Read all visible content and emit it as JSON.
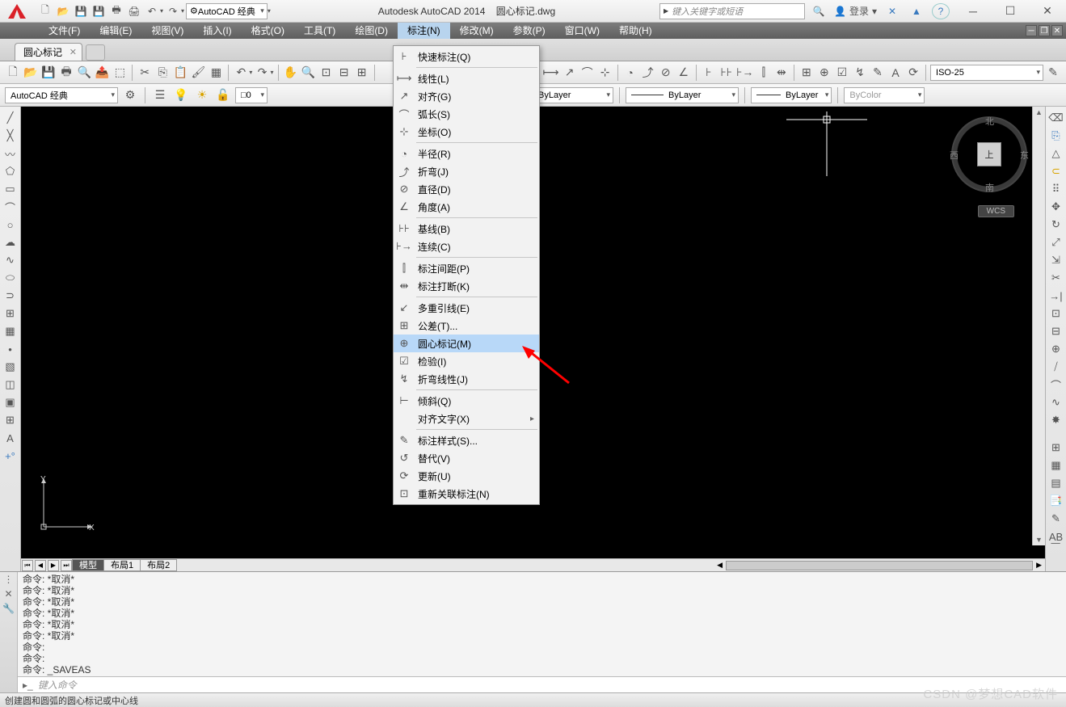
{
  "titlebar": {
    "app_icon": "A",
    "workspace_selector": "AutoCAD 经典",
    "app_title": "Autodesk AutoCAD 2014",
    "doc_title": "圆心标记.dwg",
    "search_placeholder": "键入关键字或短语",
    "login_label": "登录"
  },
  "menubar": {
    "items": [
      "文件(F)",
      "编辑(E)",
      "视图(V)",
      "插入(I)",
      "格式(O)",
      "工具(T)",
      "绘图(D)",
      "标注(N)",
      "修改(M)",
      "参数(P)",
      "窗口(W)",
      "帮助(H)"
    ],
    "active_index": 7
  },
  "doctab": {
    "label": "圆心标记"
  },
  "row2": {
    "workspace": "AutoCAD 经典",
    "layer_name": "0",
    "bylayer1": "ByLayer",
    "bylayer2": "ByLayer",
    "bylayer3": "ByLayer",
    "bycolor": "ByColor",
    "dimstyle": "ISO-25"
  },
  "viewcube": {
    "face": "上",
    "n": "北",
    "s": "南",
    "e": "东",
    "w": "西",
    "wcs": "WCS"
  },
  "layout_tabs": {
    "model": "模型",
    "l1": "布局1",
    "l2": "布局2"
  },
  "dropdown": {
    "items": [
      {
        "label": "快速标注(Q)",
        "icon": "⊦"
      },
      {
        "sep": true
      },
      {
        "label": "线性(L)",
        "icon": "⟼"
      },
      {
        "label": "对齐(G)",
        "icon": "↗"
      },
      {
        "label": "弧长(S)",
        "icon": "⌒"
      },
      {
        "label": "坐标(O)",
        "icon": "⊹"
      },
      {
        "sep": true
      },
      {
        "label": "半径(R)",
        "icon": "◔"
      },
      {
        "label": "折弯(J)",
        "icon": "⤴"
      },
      {
        "label": "直径(D)",
        "icon": "⊘"
      },
      {
        "label": "角度(A)",
        "icon": "∠"
      },
      {
        "sep": true
      },
      {
        "label": "基线(B)",
        "icon": "⊦⊦"
      },
      {
        "label": "连续(C)",
        "icon": "⊦→"
      },
      {
        "sep": true
      },
      {
        "label": "标注间距(P)",
        "icon": "⫿"
      },
      {
        "label": "标注打断(K)",
        "icon": "⇹"
      },
      {
        "sep": true
      },
      {
        "label": "多重引线(E)",
        "icon": "↙"
      },
      {
        "label": "公差(T)...",
        "icon": "⊞"
      },
      {
        "label": "圆心标记(M)",
        "icon": "⊕",
        "hl": true
      },
      {
        "label": "检验(I)",
        "icon": "☑"
      },
      {
        "label": "折弯线性(J)",
        "icon": "↯"
      },
      {
        "sep": true
      },
      {
        "label": "倾斜(Q)",
        "icon": "⊢"
      },
      {
        "label": "对齐文字(X)",
        "sub": true
      },
      {
        "sep": true
      },
      {
        "label": "标注样式(S)...",
        "icon": "✎"
      },
      {
        "label": "替代(V)",
        "icon": "↺"
      },
      {
        "label": "更新(U)",
        "icon": "⟳"
      },
      {
        "label": "重新关联标注(N)",
        "icon": "⊡"
      }
    ]
  },
  "command": {
    "lines": [
      "命令:  *取消*",
      "命令:  *取消*",
      "命令:  *取消*",
      "命令:  *取消*",
      "命令:  *取消*",
      "命令:  *取消*",
      "命令:",
      "命令:",
      "命令:  _SAVEAS"
    ],
    "prompt_placeholder": "键入命令"
  },
  "statusbar": {
    "hint": "创建圆和圆弧的圆心标记或中心线"
  },
  "watermark": "CSDN @梦想CAD软件"
}
